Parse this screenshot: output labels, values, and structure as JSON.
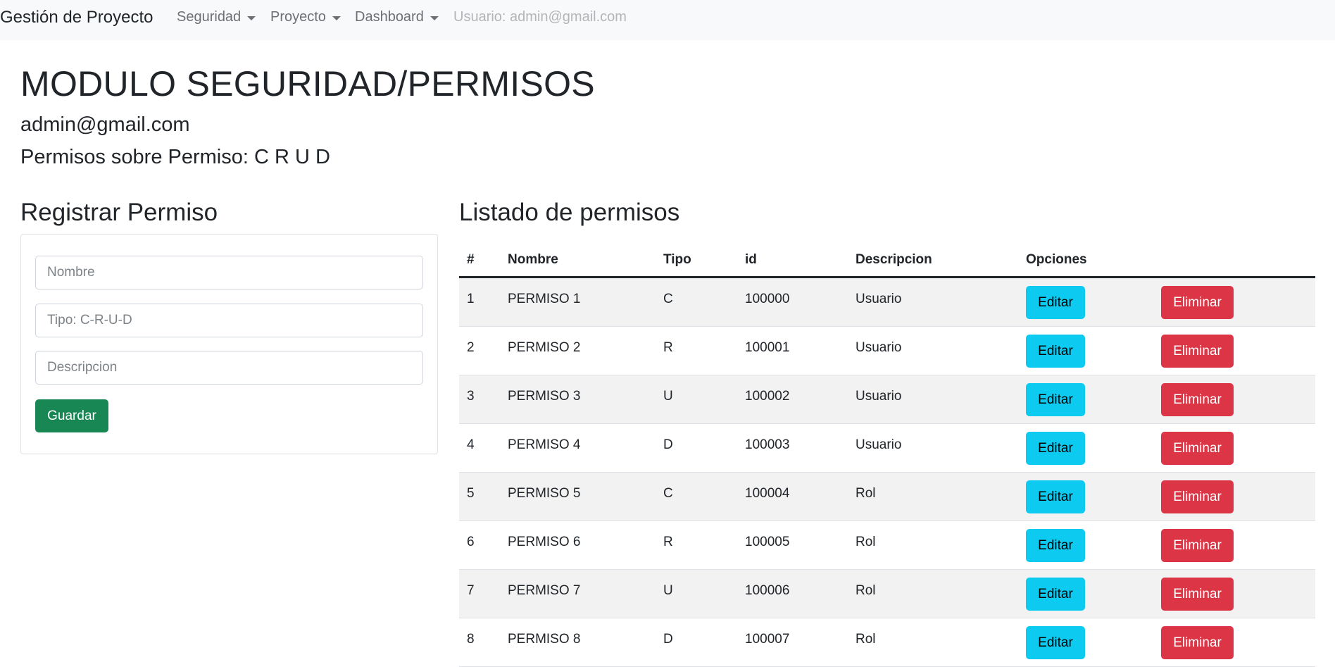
{
  "navbar": {
    "brand": "Gestión de Proyecto",
    "menus": [
      {
        "label": "Seguridad"
      },
      {
        "label": "Proyecto"
      },
      {
        "label": "Dashboard"
      }
    ],
    "user_label": "Usuario: admin@gmail.com"
  },
  "header": {
    "title": "MODULO SEGURIDAD/PERMISOS",
    "email": "admin@gmail.com",
    "permissions": "Permisos sobre Permiso: C R U D"
  },
  "form": {
    "title": "Registrar Permiso",
    "nombre_placeholder": "Nombre",
    "tipo_placeholder": "Tipo: C-R-U-D",
    "descripcion_placeholder": "Descripcion",
    "save_label": "Guardar"
  },
  "table": {
    "title": "Listado de permisos",
    "columns": [
      "#",
      "Nombre",
      "Tipo",
      "id",
      "Descripcion",
      "Opciones"
    ],
    "edit_label": "Editar",
    "delete_label": "Eliminar",
    "rows": [
      {
        "num": "1",
        "nombre": "PERMISO 1",
        "tipo": "C",
        "id": "100000",
        "descripcion": "Usuario"
      },
      {
        "num": "2",
        "nombre": "PERMISO 2",
        "tipo": "R",
        "id": "100001",
        "descripcion": "Usuario"
      },
      {
        "num": "3",
        "nombre": "PERMISO 3",
        "tipo": "U",
        "id": "100002",
        "descripcion": "Usuario"
      },
      {
        "num": "4",
        "nombre": "PERMISO 4",
        "tipo": "D",
        "id": "100003",
        "descripcion": "Usuario"
      },
      {
        "num": "5",
        "nombre": "PERMISO 5",
        "tipo": "C",
        "id": "100004",
        "descripcion": "Rol"
      },
      {
        "num": "6",
        "nombre": "PERMISO 6",
        "tipo": "R",
        "id": "100005",
        "descripcion": "Rol"
      },
      {
        "num": "7",
        "nombre": "PERMISO 7",
        "tipo": "U",
        "id": "100006",
        "descripcion": "Rol"
      },
      {
        "num": "8",
        "nombre": "PERMISO 8",
        "tipo": "D",
        "id": "100007",
        "descripcion": "Rol"
      }
    ]
  },
  "colors": {
    "save": "#198754",
    "edit": "#0dcaf0",
    "delete": "#dc3545",
    "navbar_bg": "#f8f9fa"
  }
}
